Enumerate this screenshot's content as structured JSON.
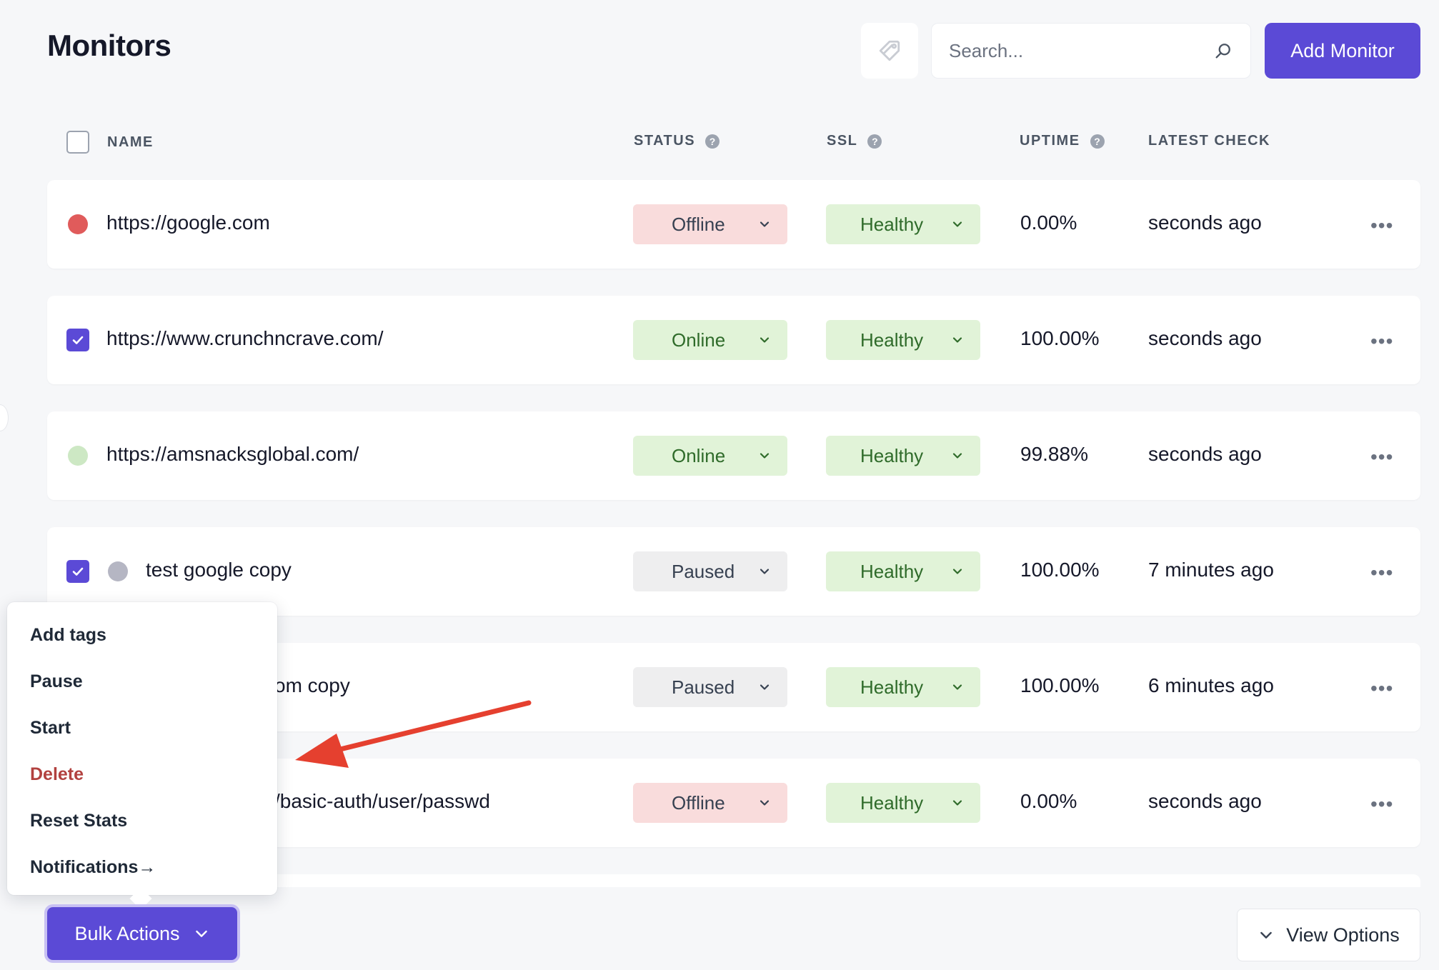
{
  "header": {
    "title": "Monitors",
    "search_placeholder": "Search...",
    "add_button": "Add Monitor"
  },
  "table": {
    "columns": {
      "name": "NAME",
      "status": "STATUS",
      "ssl": "SSL",
      "uptime": "UPTIME",
      "latest_check": "LATEST CHECK"
    },
    "help_glyph": "?",
    "rows": [
      {
        "name": "https://google.com",
        "status": "Offline",
        "ssl": "Healthy",
        "uptime": "0.00%",
        "latest_check": "seconds ago",
        "selected": false,
        "indicator": "red"
      },
      {
        "name": "https://www.crunchncrave.com/",
        "status": "Online",
        "ssl": "Healthy",
        "uptime": "100.00%",
        "latest_check": "seconds ago",
        "selected": true,
        "indicator": "none"
      },
      {
        "name": "https://amsnacksglobal.com/",
        "status": "Online",
        "ssl": "Healthy",
        "uptime": "99.88%",
        "latest_check": "seconds ago",
        "selected": false,
        "indicator": "green"
      },
      {
        "name": "test google copy",
        "status": "Paused",
        "ssl": "Healthy",
        "uptime": "100.00%",
        "latest_check": "7 minutes ago",
        "selected": true,
        "indicator": "gray"
      },
      {
        "name": "om copy",
        "status": "Paused",
        "ssl": "Healthy",
        "uptime": "100.00%",
        "latest_check": "6 minutes ago",
        "selected": false,
        "indicator": "none"
      },
      {
        "name": "/basic-auth/user/passwd",
        "status": "Offline",
        "ssl": "Healthy",
        "uptime": "0.00%",
        "latest_check": "seconds ago",
        "selected": false,
        "indicator": "none"
      }
    ],
    "more_glyph": "•••"
  },
  "bulk_menu": {
    "items": [
      "Add tags",
      "Pause",
      "Start",
      "Delete",
      "Reset Stats",
      "Notifications"
    ],
    "notifications_arrow": "→"
  },
  "footer": {
    "bulk_actions": "Bulk Actions",
    "view_options": "View Options"
  },
  "colors": {
    "primary": "#5b4ad6",
    "offline_dot": "#e05b5b",
    "online_dot": "#cde8c4",
    "paused_dot": "#b5b6c3",
    "danger_text": "#b2413f",
    "annotation_arrow": "#e5402f"
  },
  "icons": {
    "tag": "tag-icon",
    "search": "search-icon",
    "chevron": "chevron-down-icon",
    "check": "check-icon",
    "more": "more-horizontal-icon"
  }
}
